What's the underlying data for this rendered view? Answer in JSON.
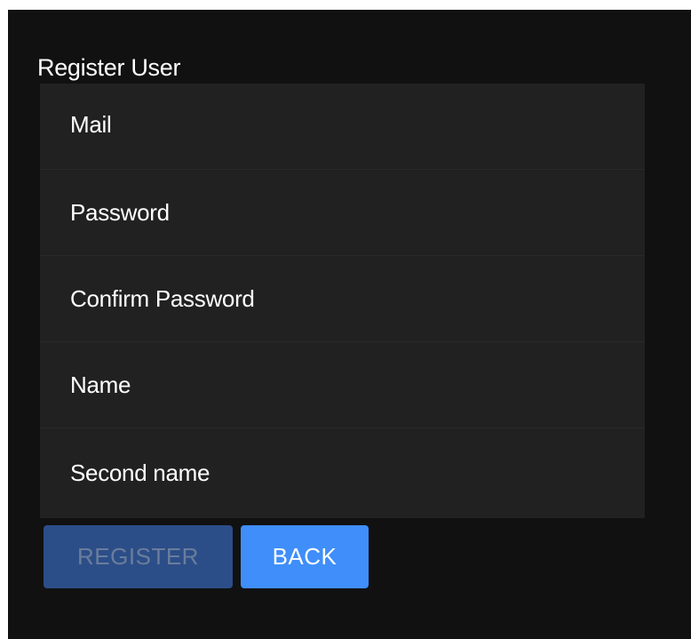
{
  "form": {
    "title": "Register User",
    "fields": [
      {
        "name": "mail",
        "placeholder": "Mail",
        "value": ""
      },
      {
        "name": "password",
        "placeholder": "Password",
        "value": ""
      },
      {
        "name": "confirm_password",
        "placeholder": "Confirm Password",
        "value": ""
      },
      {
        "name": "name",
        "placeholder": "Name",
        "value": ""
      },
      {
        "name": "second_name",
        "placeholder": "Second name",
        "value": ""
      }
    ]
  },
  "actions": {
    "register_label": "REGISTER",
    "back_label": "BACK"
  },
  "colors": {
    "background": "#111111",
    "card": "#212121",
    "primary": "#3f8ef9",
    "primary_disabled": "#2c4e88",
    "text": "#ffffff"
  }
}
